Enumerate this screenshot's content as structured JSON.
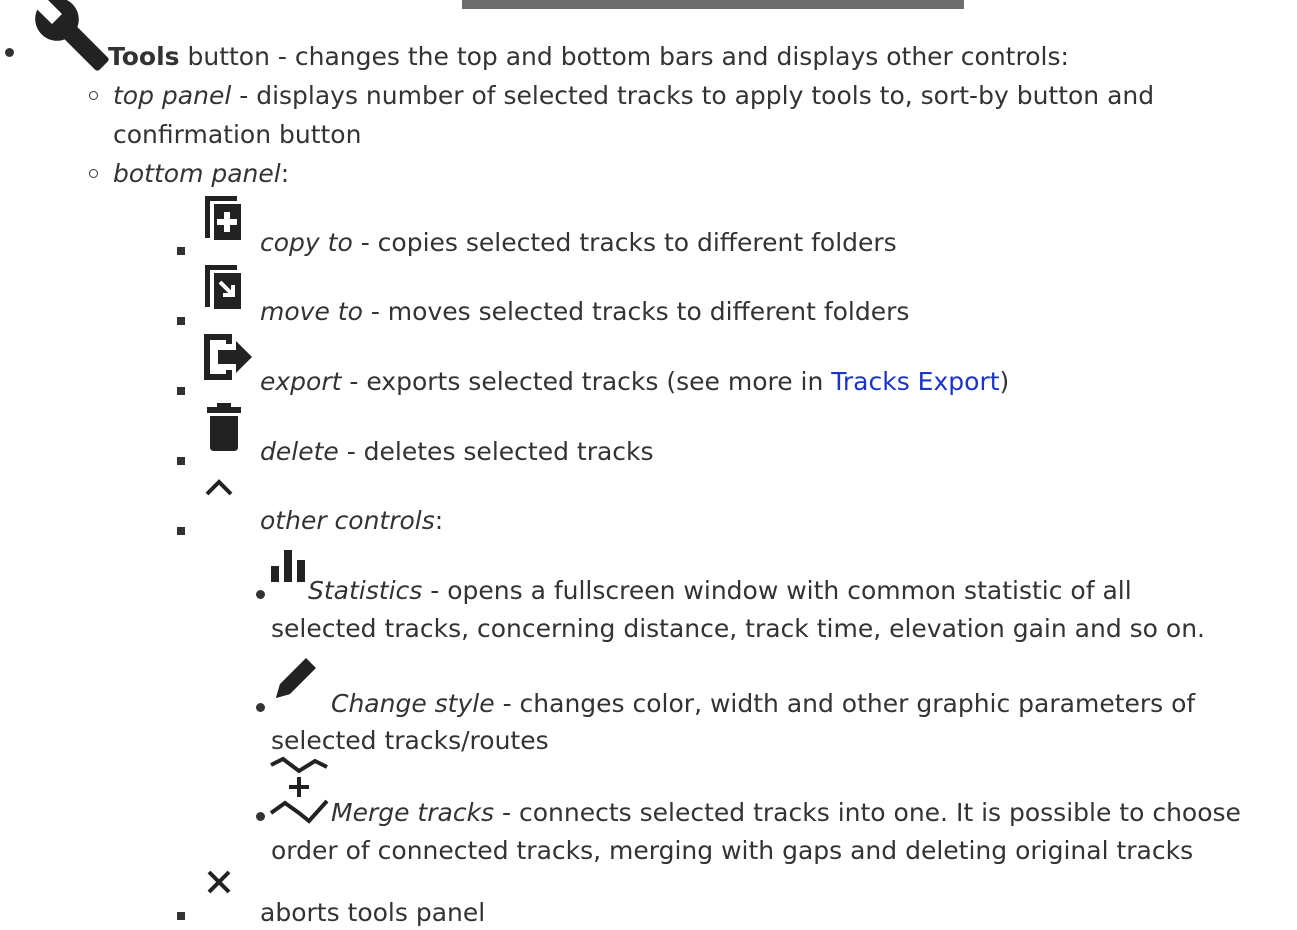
{
  "tools": {
    "title": "Tools",
    "desc": " button - changes the top and bottom bars and displays other controls:"
  },
  "top_panel": {
    "term": "top panel",
    "desc_line1": " - displays number of selected tracks to apply tools to, sort-by button and",
    "desc_line2": "confirmation button"
  },
  "bottom_panel": {
    "term": "bottom panel",
    "colon": ":"
  },
  "copy_to": {
    "term": "copy to",
    "desc": " - copies selected tracks to different folders"
  },
  "move_to": {
    "term": "move to",
    "desc": " - moves selected tracks to different folders"
  },
  "export": {
    "term": "export",
    "desc_before": " - exports selected tracks (see more in ",
    "link": "Tracks Export",
    "desc_after": ")"
  },
  "delete": {
    "term": "delete",
    "desc": " - deletes selected tracks"
  },
  "other_controls": {
    "term": "other controls",
    "colon": ":"
  },
  "statistics": {
    "term": "Statistics",
    "desc_line1": " - opens a fullscreen window with common statistic of all",
    "desc_line2": "selected tracks, concerning distance, track time, elevation gain and so on."
  },
  "change_style": {
    "term": "Change style",
    "desc_line1": " - changes color, width and other graphic parameters of",
    "desc_line2": "selected tracks/routes"
  },
  "merge_tracks": {
    "term": "Merge tracks",
    "desc_line1": " - connects selected tracks into one. It is possible to choose",
    "desc_line2": "order of connected tracks, merging with gaps and deleting original tracks"
  },
  "abort": {
    "desc": "aborts tools panel"
  },
  "colors": {
    "text": "#333333",
    "link": "#1a33cc",
    "icon": "#222222"
  }
}
